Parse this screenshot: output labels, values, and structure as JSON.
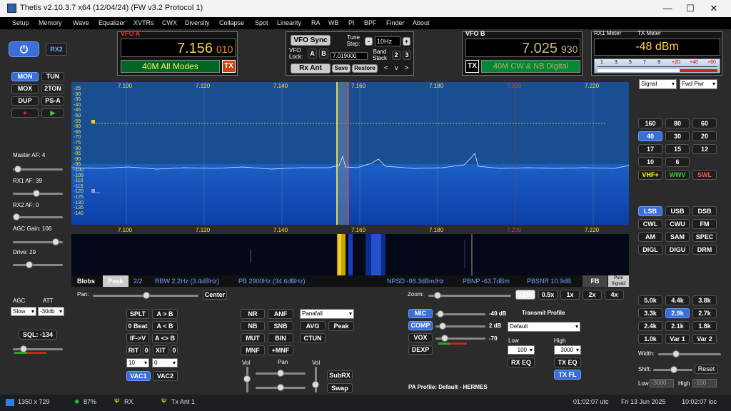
{
  "window": {
    "title": "Thetis v2.10.3.7 x64 (12/04/24) (FW v3.2 Protocol 1)",
    "min": "—",
    "max": "☐",
    "close": "✕"
  },
  "menu": [
    "Setup",
    "Memory",
    "Wave",
    "Equalizer",
    "XVTRs",
    "CWX",
    "Diversity",
    "Collapse",
    "Spot",
    "Linearity",
    "RA",
    "WB",
    "PI",
    "BPF",
    "Finder",
    "About"
  ],
  "left": {
    "power": "⏻",
    "rx2": "RX2",
    "mon": "MON",
    "tun": "TUN",
    "mox": "MOX",
    "twotone": "2TON",
    "dup": "DUP",
    "psa": "PS-A",
    "master_af": "Master AF:  4",
    "rx1_af": "RX1 AF:  39",
    "rx2_af": "RX2 AF:  0",
    "agc_gain": "AGC Gain:  106",
    "drive": "Drive:  29",
    "agc": "AGC",
    "att": "ATT",
    "agc_val": "Slow",
    "att_val": "-30db",
    "sql": "SQL: -134"
  },
  "vfo_a": {
    "label": "VFO A",
    "freq": "7.156",
    "sub": "010",
    "mode": "40M All Modes",
    "tx": "TX"
  },
  "vfo_b": {
    "label": "VFO B",
    "freq": "7.025",
    "sub": "930",
    "mode": "40M CW & NB Digital",
    "tx": "TX"
  },
  "center": {
    "sync": "VFO Sync",
    "tune_step": "Tune Step:",
    "step": "10Hz",
    "minus": "-",
    "plus": "+",
    "vfo_lock": "VFO Lock:",
    "a": "A",
    "b": "B",
    "lock_freq": "7.019000",
    "band_stack": "Band Stack",
    "bs2": "2",
    "bs3": "3",
    "rx_ant": "Rx Ant",
    "save": "Save",
    "restore": "Restore",
    "chev_down": "v",
    "chev_left": "<",
    "chev_right": ">"
  },
  "meters": {
    "rx1": "RX1 Meter",
    "tx": "TX Meter",
    "value": "-48 dBm",
    "scale": [
      "1",
      "3",
      "5",
      "7",
      "9",
      "+20",
      "+40",
      "+60"
    ],
    "sig": "Signal",
    "fwd": "Fwd Pwr"
  },
  "display": {
    "freqs": [
      "7.100",
      "7.120",
      "7.140",
      "7.160",
      "7.180",
      "7.200",
      "7.220"
    ],
    "dbs": [
      "-25",
      "-30",
      "-35",
      "-40",
      "-45",
      "-50",
      "-55",
      "-60",
      "-65",
      "-70",
      "-75",
      "-80",
      "-85",
      "-90",
      "-95",
      "-100",
      "-105",
      "-110",
      "-115",
      "-120",
      "-125",
      "-130",
      "-135",
      "-140"
    ],
    "blobs": "Blobs",
    "peak": "Peak",
    "page": "2/2",
    "rbw": "RBW 2.2Hz (3.4dBHz)",
    "pb": "PB 2900Hz (34.6dBHz)",
    "npsd": "NPSD -98.3dBm/Hz",
    "pbnp": "PBNP -63.7dBm",
    "pbsnr": "PBSNR 10.9dB",
    "fb": "FB",
    "pure": "Pure Signal2"
  },
  "pan": {
    "label": "Pan:",
    "center": "Center",
    "zoom": "Zoom:",
    "z1": "0.25x",
    "z2": "0.5x",
    "z3": "1x",
    "z4": "2x",
    "z5": "4x"
  },
  "bands": [
    "160",
    "80",
    "60",
    "40",
    "30",
    "20",
    "17",
    "15",
    "12",
    "10",
    "6",
    "",
    "VHF+",
    "WWV",
    "SWL"
  ],
  "modes": [
    "LSB",
    "USB",
    "DSB",
    "CWL",
    "CWU",
    "FM",
    "AM",
    "SAM",
    "SPEC",
    "DIGL",
    "DIGU",
    "DRM"
  ],
  "filters": [
    "5.0k",
    "4.4k",
    "3.8k",
    "3.3k",
    "2.9k",
    "2.7k",
    "2.4k",
    "2.1k",
    "1.8k",
    "1.0k",
    "Var 1",
    "Var 2"
  ],
  "width": "Width:",
  "shift": "Shift:",
  "reset": "Reset",
  "low": "Low",
  "low_val": "-3000",
  "high": "High",
  "high_val": "-100",
  "dsp": {
    "splt": "SPLT",
    "atob": "A > B",
    "beat": "0 Beat",
    "btoa": "A < B",
    "ifv": "IF->V",
    "aswap": "A <> B",
    "rit": "RIT",
    "rit_v": "0",
    "xit": "XIT",
    "xit_v": "0",
    "stepa": "10",
    "stepb": "0",
    "vac1": "VAC1",
    "vac2": "VAC2",
    "nr": "NR",
    "anf": "ANF",
    "nb": "NB",
    "snb": "SNB",
    "mut": "MUT",
    "bin": "BIN",
    "mnf": "MNF",
    "pmnf": "+MNF",
    "display_mode": "Panafall",
    "avg": "AVG",
    "peak": "Peak",
    "ctun": "CTUN",
    "vol": "Vol",
    "panlbl": "Pan",
    "vol2": "Vol",
    "subrx": "SubRX",
    "swap": "Swap"
  },
  "tx": {
    "mic": "MIC",
    "mic_v": "-40 dB",
    "comp": "COMP",
    "comp_v": "2 dB",
    "vox": "VOX",
    "vox_v": "-70",
    "dexp": "DEXP",
    "profile": "Transmit Profile",
    "profile_val": "Default",
    "low": "Low",
    "high": "High",
    "low_v": "100",
    "high_v": "3000",
    "rxeq": "RX EQ",
    "txeq": "TX EQ",
    "txfl": "TX FL",
    "pa": "PA Profile: Default - HERMES"
  },
  "status": {
    "res": "1350 x 729",
    "cpu": "87%",
    "rx": "RX",
    "ant": "Tx Ant 1",
    "utc": "01:02:07 utc",
    "date": "Fri 13 Jun 2025",
    "loc": "10:02:07 loc"
  }
}
